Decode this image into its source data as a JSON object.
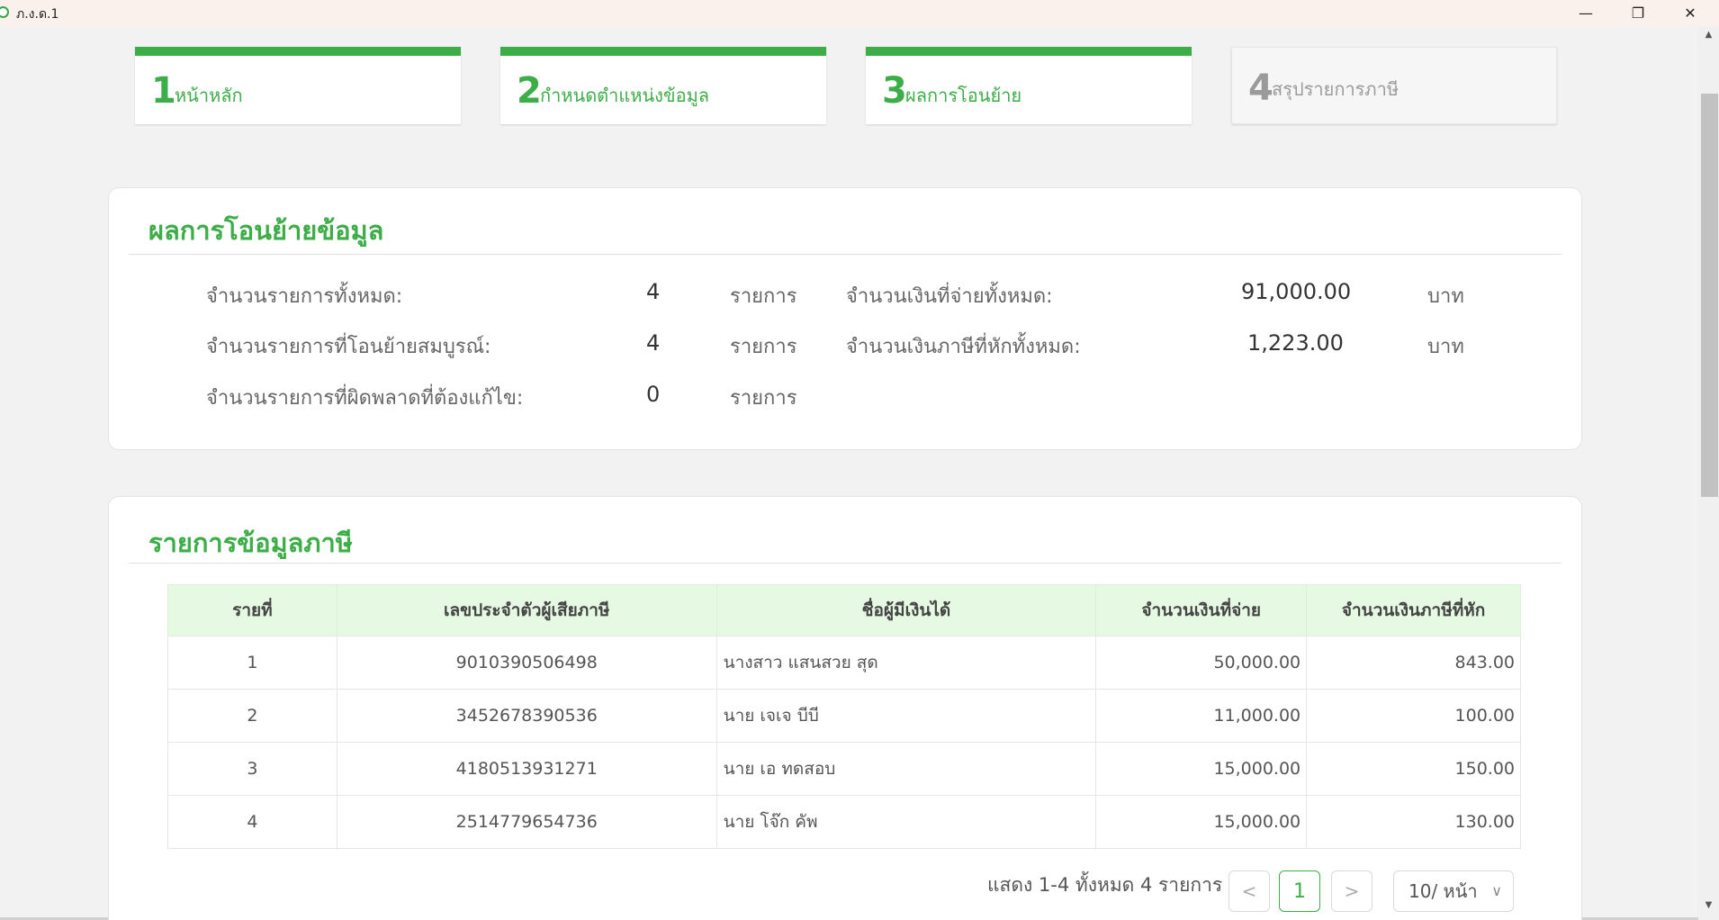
{
  "window": {
    "title": "ภ.ง.ด.1",
    "minimize": "—",
    "maximize": "❐",
    "close": "✕"
  },
  "steps": [
    {
      "num": "1",
      "label": "หน้าหลัก",
      "state": "done"
    },
    {
      "num": "2",
      "label": "กำหนดตำแหน่งข้อมูล",
      "state": "done"
    },
    {
      "num": "3",
      "label": "ผลการโอนย้าย",
      "state": "done"
    },
    {
      "num": "4",
      "label": "สรุปรายการภาษี",
      "state": "inactive"
    }
  ],
  "summary": {
    "title": "ผลการโอนย้ายข้อมูล",
    "total_items_label": "จำนวนรายการทั้งหมด:",
    "total_items_value": "4",
    "completed_items_label": "จำนวนรายการที่โอนย้ายสมบูรณ์:",
    "completed_items_value": "4",
    "error_items_label": "จำนวนรายการที่ผิดพลาดที่ต้องแก้ไข:",
    "error_items_value": "0",
    "items_unit": "รายการ",
    "total_paid_label": "จำนวนเงินที่จ่ายทั้งหมด:",
    "total_paid_value": "91,000.00",
    "total_tax_label": "จำนวนเงินภาษีที่หักทั้งหมด:",
    "total_tax_value": "1,223.00",
    "currency_unit": "บาท"
  },
  "tax_table": {
    "title": "รายการข้อมูลภาษี",
    "columns": [
      "รายที่",
      "เลขประจำตัวผู้เสียภาษี",
      "ชื่อผู้มีเงินได้",
      "จำนวนเงินที่จ่าย",
      "จำนวนเงินภาษีที่หัก"
    ],
    "rows": [
      [
        "1",
        "9010390506498",
        "นางสาว แสนสวย สุด",
        "50,000.00",
        "843.00"
      ],
      [
        "2",
        "3452678390536",
        "นาย เจเจ บีบี",
        "11,000.00",
        "100.00"
      ],
      [
        "3",
        "4180513931271",
        "นาย เอ ทดสอบ",
        "15,000.00",
        "150.00"
      ],
      [
        "4",
        "2514779654736",
        "นาย โจ๊ก คัพ",
        "15,000.00",
        "130.00"
      ]
    ]
  },
  "pagination": {
    "summary_text": "แสดง 1-4 ทั้งหมด 4 รายการ",
    "prev": "<",
    "current_page": "1",
    "next": ">",
    "page_size": "10/ หน้า"
  },
  "colors": {
    "accent": "#3dae47",
    "header_bg": "#e6f9e2"
  }
}
